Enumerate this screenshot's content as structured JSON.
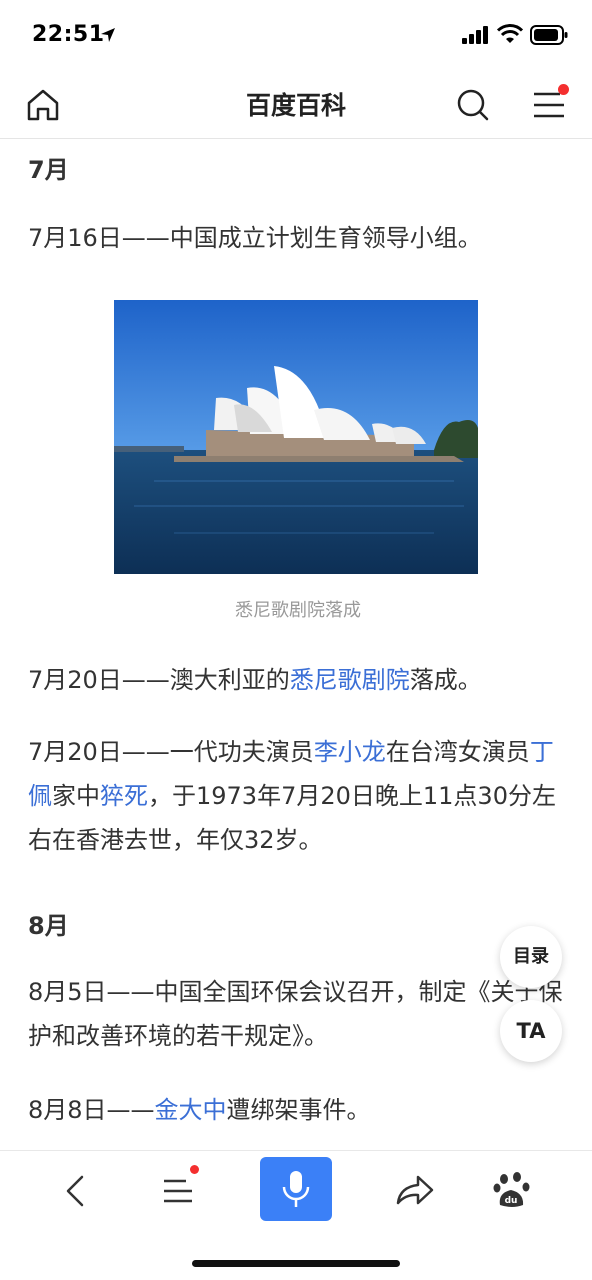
{
  "status": {
    "time": "22:51"
  },
  "nav": {
    "title": "百度百科"
  },
  "sections": {
    "july": {
      "heading": "7月"
    },
    "july16": {
      "text": "7月16日——中国成立计划生育领导小组。"
    },
    "image": {
      "caption": "悉尼歌剧院落成"
    },
    "july20a": {
      "pre": "7月20日——澳大利亚的",
      "link": "悉尼歌剧院",
      "post": "落成。"
    },
    "july20b": {
      "pre": "7月20日——一代功夫演员",
      "link1": "李小龙",
      "mid1": "在台湾女演员",
      "link2": "丁佩",
      "mid2": "家中",
      "link3": "猝死",
      "post": "，于1973年7月20日晚上11点30分左右在香港去世，年仅32岁。"
    },
    "august": {
      "heading": "8月"
    },
    "aug5": {
      "text": "8月5日——中国全国环保会议召开，制定《关于保护和改善环境的若干规定》。"
    },
    "aug8": {
      "pre": "8月8日——",
      "link": "金大中",
      "post": "遭绑架事件。"
    }
  },
  "floating": {
    "toc_label": "目录",
    "font_label": "TA"
  },
  "colors": {
    "link": "#3b6fd6",
    "accent": "#3b80f7",
    "badge": "#f42f2f"
  }
}
